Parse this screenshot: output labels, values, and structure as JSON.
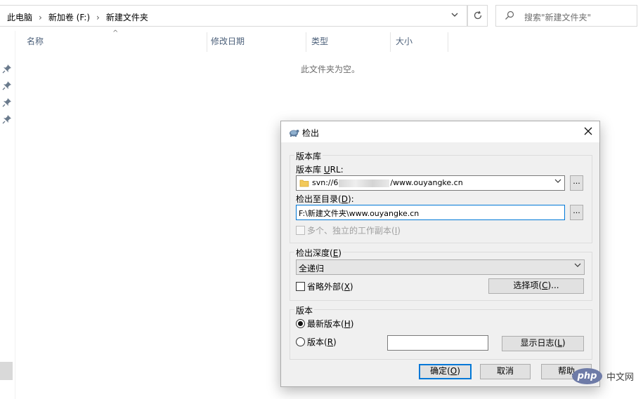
{
  "explorer": {
    "breadcrumbs": [
      "此电脑",
      "新加卷 (F:)",
      "新建文件夹"
    ],
    "search_placeholder": "搜索\"新建文件夹\"",
    "columns": [
      "名称",
      "修改日期",
      "类型",
      "大小"
    ],
    "empty_message": "此文件夹为空。"
  },
  "dialog": {
    "title": "检出",
    "repo_group": {
      "title": "版本库",
      "url_label_pre": "版本库 ",
      "url_label_u": "U",
      "url_label_post": "RL:",
      "url_prefix": "svn://6",
      "url_suffix": "/www.ouyangke.cn",
      "dir_label_pre": "检出至目录(",
      "dir_label_u": "D",
      "dir_label_post": "):",
      "dir_value": "F:\\新建文件夹\\www.ouyangke.cn",
      "browse_label": "...",
      "multi_wc_pre": "多个、独立的工作副本(",
      "multi_wc_u": "I",
      "multi_wc_post": ")"
    },
    "depth_group": {
      "title_pre": "检出深度(",
      "title_u": "E",
      "title_post": ")",
      "depth_value": "全递归",
      "omit_externals_pre": "省略外部(",
      "omit_externals_u": "X",
      "omit_externals_post": ")",
      "options_pre": "选择项(",
      "options_u": "C",
      "options_post": ")..."
    },
    "revision_group": {
      "title": "版本",
      "head_pre": "最新版本(",
      "head_u": "H",
      "head_post": ")",
      "rev_pre": "版本(",
      "rev_u": "R",
      "rev_post": ")",
      "rev_value": "",
      "show_log_pre": "显示日志(",
      "show_log_u": "L",
      "show_log_post": ")"
    },
    "buttons": {
      "ok_pre": "确定(",
      "ok_u": "O",
      "ok_post": ")",
      "cancel": "取消",
      "help": "帮助"
    }
  },
  "watermark": {
    "logo": "php",
    "site": "中文网"
  }
}
